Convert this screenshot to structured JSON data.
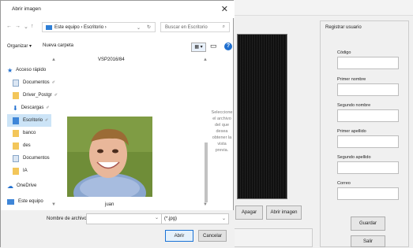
{
  "background_app": {
    "buttons": {
      "apagar": "Apagar",
      "abrir_imagen": "Abrir imagen",
      "guardar": "Guardar",
      "salir": "Salir"
    },
    "register": {
      "legend": "Registrar usuario",
      "labels": [
        "Código",
        "Primer nombre",
        "Segundo nombre",
        "Primer apellido",
        "Segundo apellido",
        "Correo"
      ]
    }
  },
  "dialog": {
    "title": "Abrir imagen",
    "close_icon": "close-icon",
    "address": {
      "segments": "Este equipo › Escritorio ›",
      "search_placeholder": "Buscar en Escritorio"
    },
    "toolbar": {
      "organize": "Organizar ▾",
      "new_folder": "Nueva carpeta",
      "view_icon": "grid-icon",
      "panel_icon": "panel-icon",
      "help_icon": "help-icon"
    },
    "nav_items": [
      {
        "label": "Acceso rápido",
        "icon": "star-icon"
      },
      {
        "label": "Documentos",
        "icon": "document-icon"
      },
      {
        "label": "Driver_Postgr",
        "icon": "folder-icon"
      },
      {
        "label": "Descargas",
        "icon": "download-icon"
      },
      {
        "label": "Escritorio",
        "icon": "folder-icon"
      },
      {
        "label": "banco",
        "icon": "folder-icon"
      },
      {
        "label": "des",
        "icon": "folder-icon"
      },
      {
        "label": "Documentos",
        "icon": "document-icon"
      },
      {
        "label": "IA",
        "icon": "folder-icon"
      },
      {
        "label": "OneDrive",
        "icon": "cloud-icon"
      },
      {
        "label": "Este equipo",
        "icon": "computer-icon"
      }
    ],
    "files": {
      "top_file": "VSP2016/84",
      "image_name": "juan"
    },
    "preview_text": "Seleccione el archivo del que desea obtener la vista previa.",
    "footer": {
      "file_name_label": "Nombre de archivo:",
      "file_name_value": "",
      "filter": "(*.jpg)",
      "open": "Abrir",
      "cancel": "Cancelar"
    }
  }
}
